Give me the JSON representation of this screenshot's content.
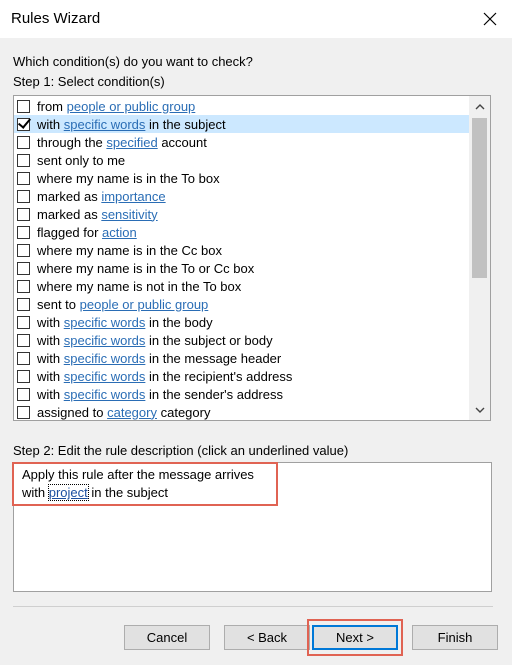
{
  "window": {
    "title": "Rules Wizard"
  },
  "prompt": "Which condition(s) do you want to check?",
  "step1_label": "Step 1: Select condition(s)",
  "conditions": [
    {
      "before": "from ",
      "link": "people or public group",
      "after": "",
      "checked": false
    },
    {
      "before": "with ",
      "link": "specific words",
      "after": " in the subject",
      "checked": true
    },
    {
      "before": "through the ",
      "link": "specified",
      "after": " account",
      "checked": false
    },
    {
      "before": "sent only to me",
      "link": "",
      "after": "",
      "checked": false
    },
    {
      "before": "where my name is in the To box",
      "link": "",
      "after": "",
      "checked": false
    },
    {
      "before": "marked as ",
      "link": "importance",
      "after": "",
      "checked": false
    },
    {
      "before": "marked as ",
      "link": "sensitivity",
      "after": "",
      "checked": false
    },
    {
      "before": "flagged for ",
      "link": "action",
      "after": "",
      "checked": false
    },
    {
      "before": "where my name is in the Cc box",
      "link": "",
      "after": "",
      "checked": false
    },
    {
      "before": "where my name is in the To or Cc box",
      "link": "",
      "after": "",
      "checked": false
    },
    {
      "before": "where my name is not in the To box",
      "link": "",
      "after": "",
      "checked": false
    },
    {
      "before": "sent to ",
      "link": "people or public group",
      "after": "",
      "checked": false
    },
    {
      "before": "with ",
      "link": "specific words",
      "after": " in the body",
      "checked": false
    },
    {
      "before": "with ",
      "link": "specific words",
      "after": " in the subject or body",
      "checked": false
    },
    {
      "before": "with ",
      "link": "specific words",
      "after": " in the message header",
      "checked": false
    },
    {
      "before": "with ",
      "link": "specific words",
      "after": " in the recipient's address",
      "checked": false
    },
    {
      "before": "with ",
      "link": "specific words",
      "after": " in the sender's address",
      "checked": false
    },
    {
      "before": "assigned to ",
      "link": "category",
      "after": " category",
      "checked": false
    }
  ],
  "selected_index": 1,
  "step2_label": "Step 2: Edit the rule description (click an underlined value)",
  "description": {
    "line1": "Apply this rule after the message arrives",
    "line2_before": "with ",
    "line2_link": "project",
    "line2_after": " in the subject"
  },
  "buttons": {
    "cancel": "Cancel",
    "back": "< Back",
    "next": "Next >",
    "finish": "Finish"
  },
  "colors": {
    "highlight": "#e06353",
    "link": "#2a6db5",
    "selection": "#cce8ff",
    "default_border": "#0078d7"
  }
}
